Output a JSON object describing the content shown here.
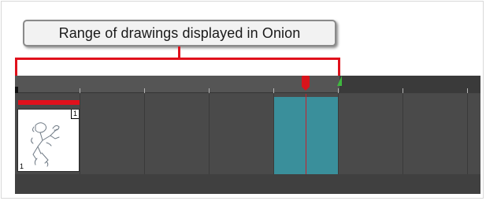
{
  "callout": {
    "text": "Range of drawings displayed in Onion"
  },
  "timeline": {
    "drawing_thumbnail": {
      "top_right_number": "1",
      "bottom_left_number": "1"
    }
  },
  "colors": {
    "bracket": "#e0111c",
    "onion_range": "#3a8f9b",
    "playhead": "#d8141c",
    "onion_marker": "#3fb83f"
  }
}
